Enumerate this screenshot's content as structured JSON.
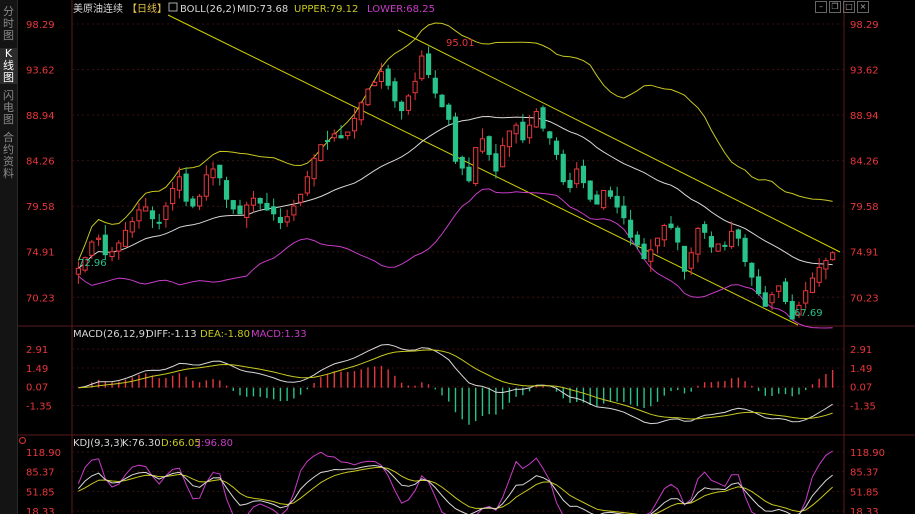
{
  "sidebar": {
    "items": [
      {
        "label": "分时图",
        "active": false
      },
      {
        "label": "K线图",
        "active": true
      },
      {
        "label": "闪电图",
        "active": false
      },
      {
        "label": "合约资料",
        "active": false
      }
    ]
  },
  "window_buttons": [
    "minimize-icon",
    "restore-icon",
    "maximize-icon",
    "close-icon"
  ],
  "main_panel": {
    "title": "美原油连续",
    "period": "【日线】",
    "indicator": "BOLL(26,2)",
    "mid_label": "MID:73.68",
    "upper_label": "UPPER:79.12",
    "lower_label": "LOWER:68.25",
    "price_ticks": [
      "98.29",
      "93.62",
      "88.94",
      "84.26",
      "79.58",
      "74.91",
      "70.23"
    ],
    "high_annotation": "95.01",
    "low_annotation_left": "72.96",
    "low_annotation_right": "67.69"
  },
  "macd_panel": {
    "label": "MACD(26,12,9)",
    "diff": "DIFF:-1.13",
    "dea": "DEA:-1.80",
    "macd": "MACD:1.33",
    "ticks": [
      "2.91",
      "1.49",
      "0.07",
      "-1.35"
    ]
  },
  "kdj_panel": {
    "label": "KDJ(9,3,3)",
    "k": "K:76.30",
    "d": "D:66.05",
    "j": "J:96.80",
    "ticks": [
      "118.90",
      "85.37",
      "51.85",
      "18.33"
    ]
  },
  "colors": {
    "up": "#e8373b",
    "down": "#28c38a",
    "mid": "#d8d8d8",
    "upper": "#c8c820",
    "lower": "#c83cc8",
    "trend": "#d0d000",
    "grid": "#3a1010"
  },
  "chart_data": [
    {
      "type": "candlestick",
      "title": "美原油连续 【日线】",
      "ylim": [
        67.69,
        98.29
      ],
      "y_ticks": [
        98.29,
        93.62,
        88.94,
        84.26,
        79.58,
        74.91,
        70.23
      ],
      "close": [
        73.2,
        74.3,
        75.9,
        76.3,
        74.6,
        74.9,
        75.8,
        77.1,
        78.0,
        79.2,
        79.5,
        78.3,
        77.9,
        79.6,
        81.4,
        82.6,
        80.1,
        79.6,
        80.6,
        82.8,
        83.4,
        82.5,
        80.3,
        79.3,
        78.8,
        79.7,
        80.4,
        79.9,
        79.2,
        78.8,
        77.9,
        78.5,
        79.6,
        80.8,
        82.6,
        84.5,
        85.9,
        86.3,
        87.0,
        86.6,
        87.2,
        88.6,
        90.2,
        91.6,
        92.3,
        93.4,
        92.0,
        90.4,
        89.4,
        90.9,
        92.4,
        95.0,
        93.1,
        91.2,
        89.8,
        88.5,
        84.2,
        83.5,
        82.2,
        85.6,
        86.5,
        84.9,
        83.2,
        85.8,
        87.3,
        87.9,
        86.4,
        87.9,
        89.3,
        87.6,
        86.6,
        84.9,
        82.1,
        81.5,
        83.4,
        82.0,
        80.3,
        79.8,
        81.2,
        80.6,
        79.5,
        78.4,
        76.4,
        75.6,
        74.2,
        75.1,
        76.3,
        77.6,
        77.4,
        75.9,
        72.9,
        74.8,
        77.3,
        76.9,
        75.4,
        75.7,
        75.5,
        77.0,
        76.3,
        73.9,
        72.3,
        70.6,
        69.3,
        70.5,
        71.4,
        69.8,
        68.0,
        69.4,
        70.9,
        72.2,
        73.3,
        74.0,
        74.8
      ],
      "series_meta": [
        {
          "name": "MID"
        },
        {
          "name": "UPPER"
        },
        {
          "name": "LOWER"
        }
      ],
      "last_values": {
        "MID": 73.68,
        "UPPER": 79.12,
        "LOWER": 68.25
      },
      "annotations": [
        {
          "text": "95.01",
          "value": 95.01
        },
        {
          "text": "72.96",
          "value": 72.96
        },
        {
          "text": "67.69",
          "value": 67.69
        }
      ]
    },
    {
      "type": "line",
      "title": "MACD(26,12,9)",
      "ylim": [
        -3.2,
        3.3
      ],
      "y_ticks": [
        2.91,
        1.49,
        0.07,
        -1.35
      ],
      "last_values": {
        "DIFF": -1.13,
        "DEA": -1.8,
        "MACD": 1.33
      }
    },
    {
      "type": "line",
      "title": "KDJ(9,3,3)",
      "ylim": [
        18.33,
        118.9
      ],
      "y_ticks": [
        118.9,
        85.37,
        51.85,
        18.33
      ],
      "last_values": {
        "K": 76.3,
        "D": 66.05,
        "J": 96.8
      }
    }
  ]
}
